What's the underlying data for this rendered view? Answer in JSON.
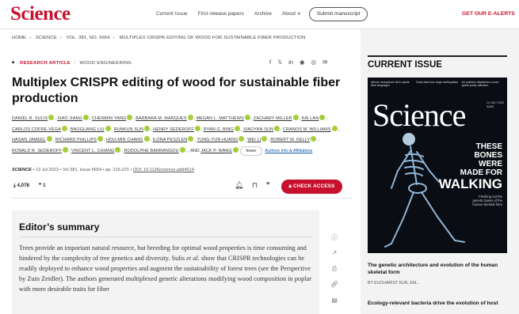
{
  "nav": {
    "logo": "Science",
    "links": [
      "Current Issue",
      "First release papers",
      "Archive",
      "About ∨"
    ],
    "submit": "Submit manuscript",
    "subscribe": "GET OUR E-ALERTS"
  },
  "breadcrumb": [
    "HOME",
    "SCIENCE",
    "VOL. 381, NO. 6654",
    "MULTIPLEX CRISPR EDITING OF WOOD FOR SUSTAINABLE FIBER PRODUCTION"
  ],
  "article": {
    "type": "RESEARCH ARTICLE",
    "topic": "WOOD ENGINEERING",
    "title": "Multiplex CRISPR editing of wood for sustainable fiber production",
    "authors": [
      "DANIEL B. SULIS",
      "XIAO JIANG",
      "CHENMIN YANG",
      "BARBARA M. MARQUES",
      "MEGAN L. MATTHEWS",
      "ZACHARY MILLER",
      "KAI LAN",
      "CARLOS COFRE-VEGA",
      "BAOGUANG LIU",
      "RUNKUN SUN",
      "HENRY SEDEROFF",
      "RYAN G. BING",
      "XIAOYAN SUN",
      "CRANOS M. WILLIAMS",
      "HASAN JAMEEL",
      "RICHARD PHILLIPS",
      "HOU-MIN CHANG",
      "ILONA PESZLEN",
      "YUNG-YUN HUANG",
      "WEI LI",
      "ROBERT M. KELLY",
      "RONALD R. SEDEROFF",
      "VINCENT L. CHIANG",
      "RODOLPHE BARRANGOU"
    ],
    "last_author_prefix": ", AND",
    "last_author": "JACK P. WANG",
    "tower_label": "fewer",
    "affiliations": "Authors Info & Affiliations",
    "journal": "SCIENCE",
    "date": "13 Jul 2023",
    "volume": "Vol 381, Issue 6654",
    "pages": "pp. 216-221",
    "doi": "DOI: 10.1126/science.add4514",
    "downloads": "4,078",
    "citations": "1",
    "access_label": "CHECK ACCESS"
  },
  "summary": {
    "heading": "Editor’s summary",
    "text_before": "Trees provide an important natural resource, but breeding for optimal wood properties is time consuming and hindered by the complexity of tree genetics and diversity. Sulis ",
    "text_italic": "et al.",
    "text_after": " show that CRISPR technologies can be readily deployed to enhance wood properties and augment the sustainability of forest trees (see the Perspective by Zuin Zeidler). The authors generated multiplexed genetic alterations modifying wood composition in poplar with more desirable traits for fiber"
  },
  "sidebar": {
    "heading": "CURRENT ISSUE",
    "cover": {
      "title": "Science",
      "headline_small": "THESE BONES WERE MADE FOR",
      "headline_big": "WALKING",
      "subtext": "Fleshing out the genetic bases of the human skeletal form",
      "top1": "African mosquitoes hit to speak their languages",
      "top2": "Early data from large earthquakes",
      "top3": "Air pollution dispatches a poor global policy attention",
      "date": "14 JULY 2023",
      "brand": "AAAS"
    },
    "article1": "The genetic architecture and evolution of the human skeletal form",
    "byline": "BY EUCHARIST KUN, EM...",
    "article2": "Ecology-relevant bacteria drive the evolution of host"
  },
  "colors": {
    "brand_red": "#c8102e",
    "orcid_green": "#a6ce39",
    "summary_bg": "#f3f3f3",
    "sidebar_bg": "#f3f3f3"
  }
}
